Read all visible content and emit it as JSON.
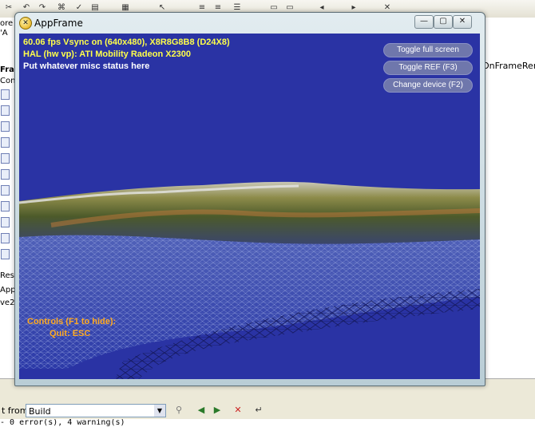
{
  "ide": {
    "left_labels": [
      "ore",
      "'A",
      "Fra",
      "Con",
      "Rese",
      "App",
      "ve2"
    ],
    "right_label": "OnFrameRend",
    "output_from_label": "t from:",
    "output_select_value": "Build",
    "output_line": "- 0 error(s), 4 warning(s)"
  },
  "app": {
    "title": "AppFrame",
    "buttons": {
      "minimize": "—",
      "maximize": "▢",
      "close": "✕"
    },
    "stats": {
      "line1": "60.06 fps Vsync on (640x480), X8R8G8B8 (D24X8)",
      "line2": "HAL (hw vp): ATI Mobility Radeon X2300",
      "line3": "Put whatever misc status here"
    },
    "hud_buttons": {
      "fullscreen": "Toggle full screen",
      "ref": "Toggle REF (F3)",
      "device": "Change device (F2)"
    },
    "controls": {
      "heading": "Controls (F1 to hide):",
      "quit": "Quit: ESC"
    }
  },
  "colors": {
    "viewport_bg": "#2a33a4",
    "stat_yellow": "#ffff4a",
    "stat_white": "#ffffff",
    "controls_orange": "#ffaa22"
  }
}
